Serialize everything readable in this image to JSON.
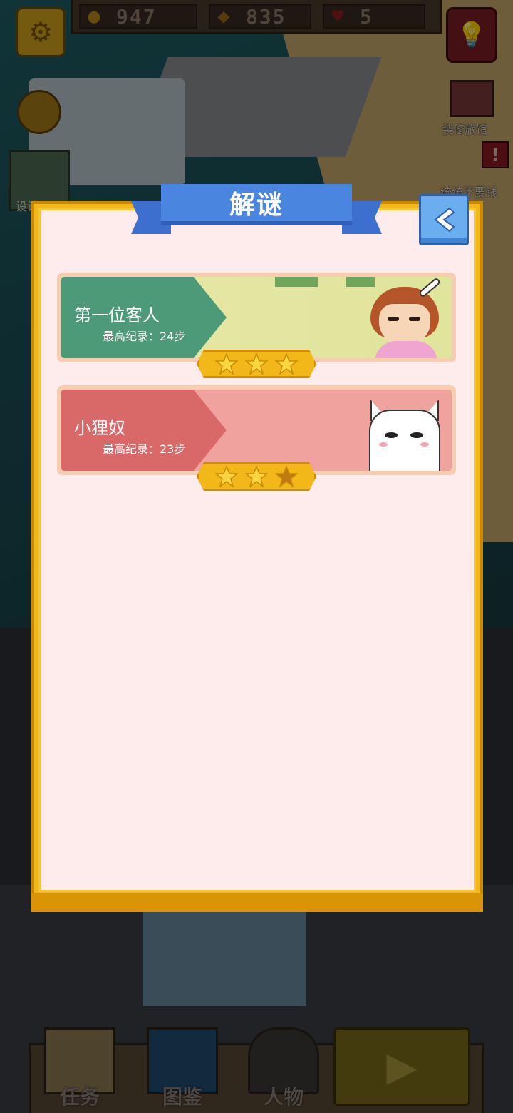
{
  "hud": {
    "coins": "947",
    "fish": "835",
    "hearts": "5",
    "renovate_label": "装修旅馆",
    "alert_badge": "!",
    "never_label": "统统不要钱",
    "design_label": "设计"
  },
  "dialog": {
    "title": "解谜",
    "back_icon": "chevron-left-icon",
    "levels": [
      {
        "name": "第一位客人",
        "record": "最高纪录：24步",
        "stars_earned": 3,
        "stars_total": 3,
        "character": "girl-with-bone"
      },
      {
        "name": "小狸奴",
        "record": "最高纪录：23步",
        "stars_earned": 2,
        "stars_total": 3,
        "character": "white-cat"
      }
    ]
  },
  "bottom_tabs": [
    {
      "label": "任务"
    },
    {
      "label": "图鉴"
    },
    {
      "label": "人物"
    }
  ],
  "colors": {
    "dialog_bg": "#fdeceb",
    "frame": "#f2b81a",
    "title_ribbon": "#4a86e0",
    "card1_banner": "#4c9a78",
    "card2_banner": "#d96868",
    "star_filled": "#f7d640",
    "star_empty": "#c07a10"
  }
}
